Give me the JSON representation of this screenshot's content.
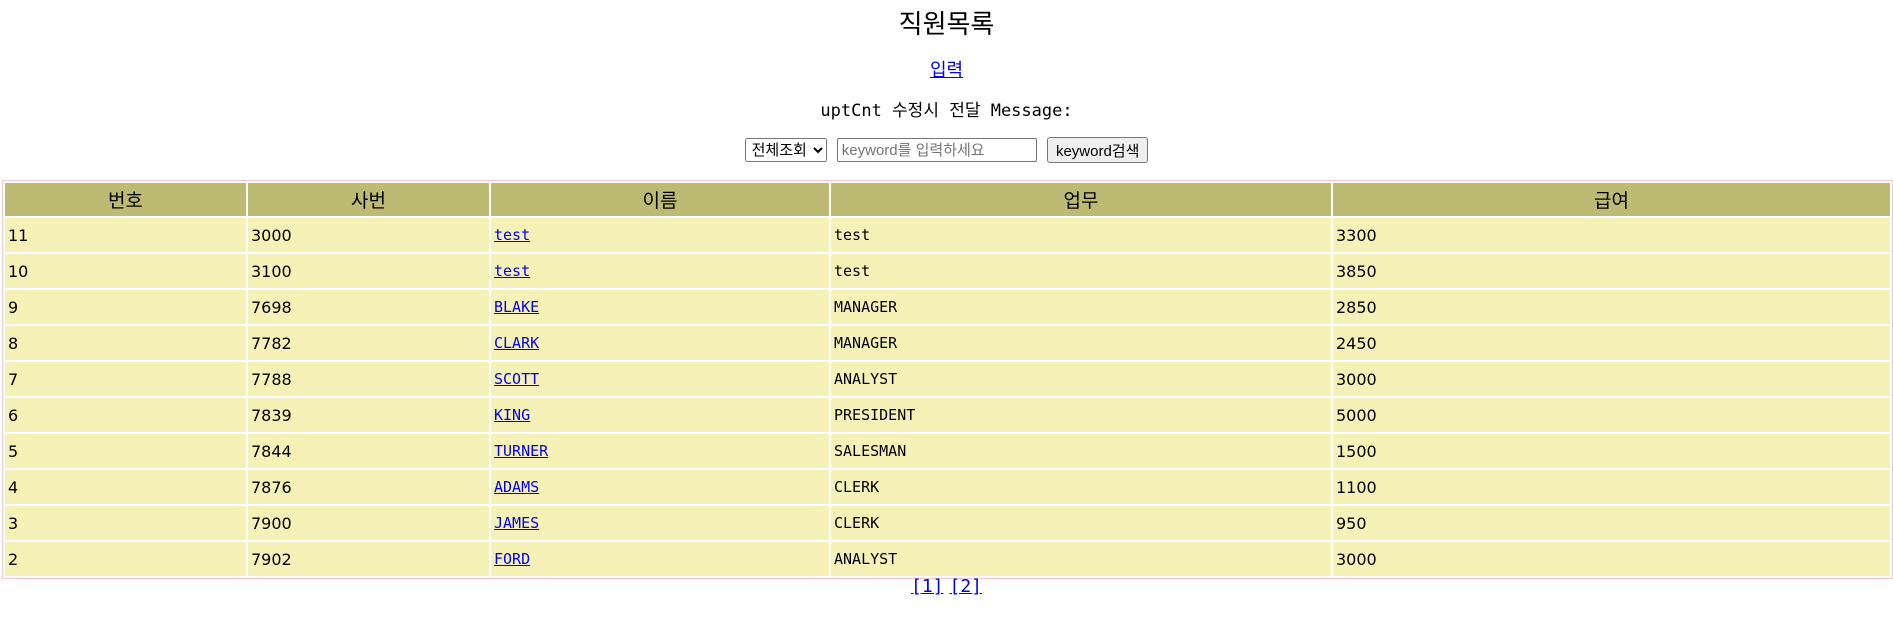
{
  "page": {
    "title": "직원목록",
    "insert_link": "입력",
    "message": "uptCnt 수정시 전달 Message:"
  },
  "search": {
    "select_value": "전체조회",
    "placeholder": "keyword를 입력하세요",
    "button_label": "keyword검색"
  },
  "table": {
    "headers": [
      "번호",
      "사번",
      "이름",
      "업무",
      "급여"
    ],
    "rows": [
      {
        "no": "11",
        "empno": "3000",
        "ename": "test",
        "job": "test",
        "sal": "3300"
      },
      {
        "no": "10",
        "empno": "3100",
        "ename": "test",
        "job": "test",
        "sal": "3850"
      },
      {
        "no": "9",
        "empno": "7698",
        "ename": "BLAKE",
        "job": "MANAGER",
        "sal": "2850"
      },
      {
        "no": "8",
        "empno": "7782",
        "ename": "CLARK",
        "job": "MANAGER",
        "sal": "2450"
      },
      {
        "no": "7",
        "empno": "7788",
        "ename": "SCOTT",
        "job": "ANALYST",
        "sal": "3000"
      },
      {
        "no": "6",
        "empno": "7839",
        "ename": "KING",
        "job": "PRESIDENT",
        "sal": "5000"
      },
      {
        "no": "5",
        "empno": "7844",
        "ename": "TURNER",
        "job": "SALESMAN",
        "sal": "1500"
      },
      {
        "no": "4",
        "empno": "7876",
        "ename": "ADAMS",
        "job": "CLERK",
        "sal": "1100"
      },
      {
        "no": "3",
        "empno": "7900",
        "ename": "JAMES",
        "job": "CLERK",
        "sal": "950"
      },
      {
        "no": "2",
        "empno": "7902",
        "ename": "FORD",
        "job": "ANALYST",
        "sal": "3000"
      }
    ]
  },
  "pagination": {
    "pages": [
      "[1]",
      "[2]"
    ]
  },
  "colors": {
    "header_bg": "#bdba74",
    "row_bg": "#f6f2b7",
    "link": "#0000ee"
  }
}
